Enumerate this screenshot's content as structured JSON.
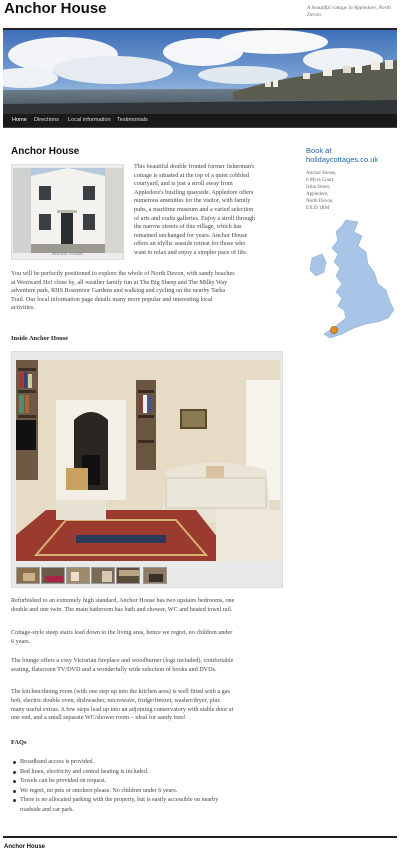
{
  "site": {
    "title": "Anchor House",
    "tagline": "A beautiful cottage in Appledore, North Devon"
  },
  "nav": {
    "items": [
      "Home",
      "Directions",
      "Local information",
      "Testimonials"
    ],
    "active": "Home"
  },
  "main": {
    "title": "Anchor House",
    "photo_caption": "Anchor house",
    "intro_lines": [
      "This beautiful double fronted former fisherman's",
      "cottage is situated at the top of a quiet cobbled",
      "courtyard, and is just a stroll away from",
      "Appledore's bustling quayside.  Appledore offers",
      "numerous amenities for the visitor, with family",
      "pubs, a maritime museum and a varied selection",
      "of arts and crafts galleries.  Enjoy a stroll through",
      "the narrow streets of this village, which has",
      "remained unchanged for years.  Anchor House",
      "offers an idyllic seaside retreat for those who",
      "want to relax and enjoy a simpler pace of life."
    ],
    "intro_cont_lines": [
      "You will be perfectly positioned to explore the whole of North Devon, with sandy beaches",
      "at Westward Ho! close by, all weather family fun at The Big Sheep and The Milky Way",
      "adventure park, RHS Rosemoor Gardens and walking and cycling on the nearby Tarka",
      "Trail.  Our local information page details many more popular and interesting local",
      "activities."
    ],
    "inside_heading": "Inside Anchor House",
    "p_refurb": [
      "Refurbished to an extremely high standard, Anchor House has two upstairs bedrooms, one",
      "double and one twin.  The main bathroom has bath and shower, WC and heated towel rail."
    ],
    "p_stairs": [
      "Cottage-style steep stairs lead down to the living area, hence we regret, no children under",
      "6 years."
    ],
    "p_lounge": [
      "The lounge offers a cosy Victorian fireplace and woodburner (logs included), comfortable",
      "seating, flatscreen TV/DVD and a wonderfully wide selection of books and DVDs."
    ],
    "p_kitchen": [
      "The kitchen/dining room (with one step up into the kitchen area) is well fitted with a gas",
      "hob, electric double oven, dishwasher, microwave, fridge/freezer, washer/dryer, plus",
      "many useful extras.  A few steps lead up into an adjoining conservatory with stable door at",
      "one end, and a small separate WC/shower room – ideal for sandy toes!"
    ],
    "faq_heading": "FAQs",
    "faqs": [
      "Broadband access is provided.",
      "Bed linen, electricity and central heating is included.",
      "Towels can be provided on request.",
      "We regret, no pets or smokers please. No children under 6 years.",
      "There is no allocated parking with the property, but is easily accessible on nearby",
      "roadside and car park."
    ]
  },
  "sidebar": {
    "book_title_lines": [
      "Book at",
      "holidaycottages.co.uk"
    ],
    "address_lines": [
      "Anchor House,",
      "6 Myra Court,",
      "Irsha Street,",
      "Appledore,",
      "North Devon,",
      "EX39 1RM"
    ]
  },
  "footer": {
    "text": "Anchor House"
  },
  "colors": {
    "link": "#2266aa",
    "nav_bg": "#1a1a1a",
    "map_land": "#a8c4e6",
    "map_marker": "#e09020"
  }
}
